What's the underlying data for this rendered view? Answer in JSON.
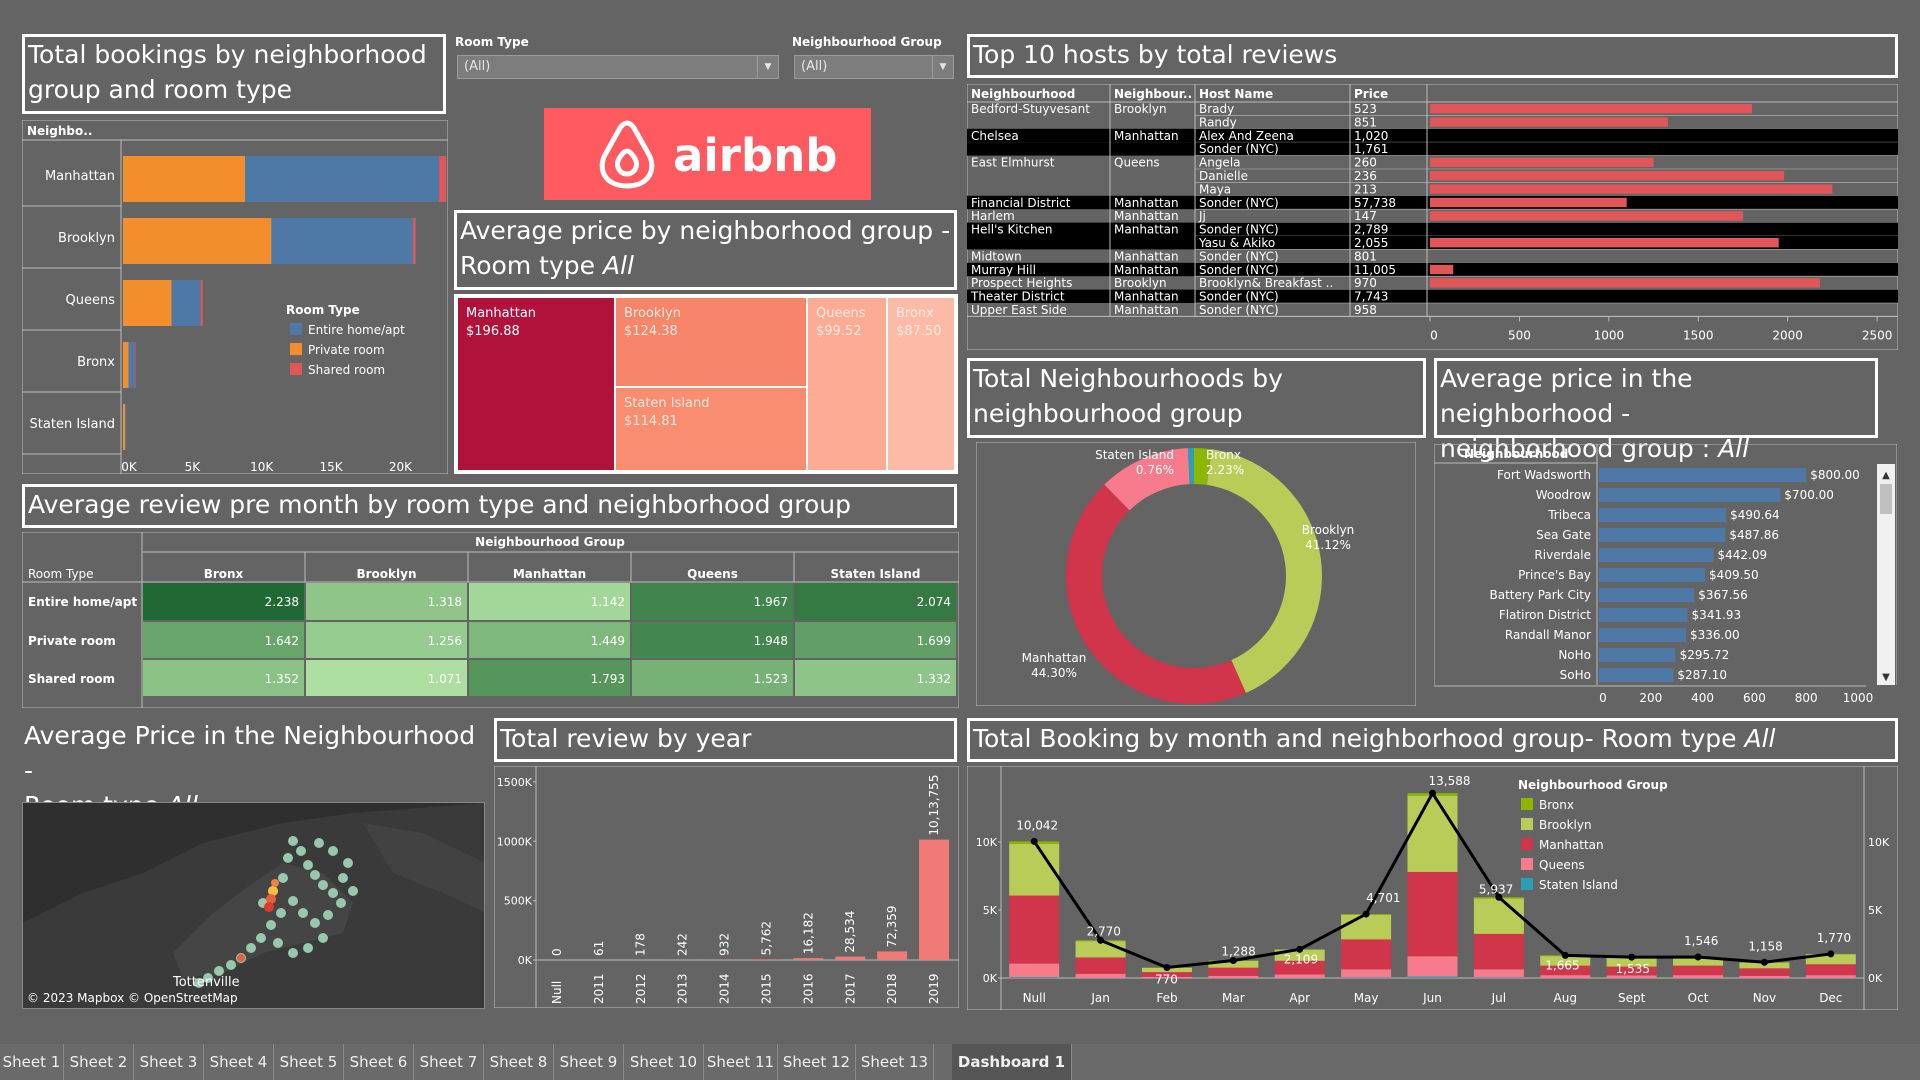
{
  "titles": {
    "bookings": "Total bookings by neighborhood\ngroup and room type",
    "avgprice_prefix": "Average price by neighborhood group -\nRoom type ",
    "avgprice_all": "All",
    "review_month": "Average review pre month by room type and neighborhood group",
    "map_prefix": "Average Price in the Neighbourhood -\nRoom type ",
    "map_all": "All",
    "review_year": "Total review by year",
    "top_hosts": "Top 10 hosts by total reviews",
    "total_neigh": "Total Neighbourhoods by\nneighbourhood group",
    "avg_neigh_prefix": "Average price in the neighborhood -\nneighborhood group : ",
    "avg_neigh_all": "All",
    "booking_month_prefix": "Total Booking by month and neighborhood group- Room type ",
    "booking_month_all": "All"
  },
  "filters": {
    "room_type_label": "Room Type",
    "room_type_value": "(All)",
    "neigh_group_label": "Neighbourhood Group",
    "neigh_group_value": "(All)"
  },
  "logo": {
    "text": "airbnb",
    "color": "#ff5a5f"
  },
  "map": {
    "place": "Tottenville",
    "credit": "© 2023 Mapbox © OpenStreetMap"
  },
  "tabs": [
    "Sheet 1",
    "Sheet 2",
    "Sheet 3",
    "Sheet 4",
    "Sheet 5",
    "Sheet 6",
    "Sheet 7",
    "Sheet 8",
    "Sheet 9",
    "Sheet 10",
    "Sheet 11",
    "Sheet 12",
    "Sheet 13",
    "Dashboard 1"
  ],
  "chart_data": [
    {
      "id": "bookings",
      "type": "bar",
      "orientation": "horizontal",
      "stacked": true,
      "row_header": "Neighbo..",
      "categories": [
        "Manhattan",
        "Brooklyn",
        "Queens",
        "Bronx",
        "Staten Island"
      ],
      "series": [
        {
          "name": "Private room",
          "color": "#f28e2b",
          "values": [
            8800,
            10700,
            3500,
            400,
            150
          ]
        },
        {
          "name": "Entire home/apt",
          "color": "#4e79a7",
          "values": [
            14000,
            10200,
            2100,
            450,
            80
          ]
        },
        {
          "name": "Shared room",
          "color": "#e15759",
          "values": [
            500,
            200,
            150,
            50,
            10
          ]
        }
      ],
      "legend_title": "Room Type",
      "legend": [
        {
          "name": "Entire home/apt",
          "color": "#4e79a7"
        },
        {
          "name": "Private room",
          "color": "#f28e2b"
        },
        {
          "name": "Shared room",
          "color": "#e15759"
        }
      ],
      "xlim": [
        0,
        23000
      ],
      "xticks": [
        "0K",
        "5K",
        "10K",
        "15K",
        "20K"
      ],
      "xtick_values": [
        0,
        5000,
        10000,
        15000,
        20000
      ]
    },
    {
      "id": "treemap",
      "type": "treemap",
      "items": [
        {
          "name": "Manhattan",
          "value": "$196.88",
          "color": "#b0123c"
        },
        {
          "name": "Brooklyn",
          "value": "$124.38",
          "color": "#f7856a"
        },
        {
          "name": "Staten Island",
          "value": "$114.81",
          "color": "#f98d70"
        },
        {
          "name": "Queens",
          "value": "$99.52",
          "color": "#fcab94"
        },
        {
          "name": "Bronx",
          "value": "$87.50",
          "color": "#fdbaa6"
        }
      ]
    },
    {
      "id": "review_month",
      "type": "heatmap",
      "group_header": "Neighbourhood Group",
      "row_header": "Room Type",
      "columns": [
        "Bronx",
        "Brooklyn",
        "Manhattan",
        "Queens",
        "Staten Island"
      ],
      "rows": [
        {
          "label": "Entire home/apt",
          "values": [
            "2.238",
            "1.318",
            "1.142",
            "1.967",
            "2.074"
          ]
        },
        {
          "label": "Private room",
          "values": [
            "1.642",
            "1.256",
            "1.449",
            "1.948",
            "1.699"
          ]
        },
        {
          "label": "Shared room",
          "values": [
            "1.352",
            "1.071",
            "1.793",
            "1.523",
            "1.332"
          ]
        }
      ]
    },
    {
      "id": "review_year",
      "type": "bar",
      "categories": [
        "Null",
        "2011",
        "2012",
        "2013",
        "2014",
        "2015",
        "2016",
        "2017",
        "2018",
        "2019"
      ],
      "values": [
        0,
        61,
        178,
        242,
        932,
        5762,
        16182,
        28534,
        72359,
        1013755
      ],
      "labels": [
        "0",
        "61",
        "178",
        "242",
        "932",
        "5,762",
        "16,182",
        "28,534",
        "72,359",
        "10,13,755"
      ],
      "ylim": [
        0,
        1600000
      ],
      "yticks": [
        "0K",
        "500K",
        "1000K",
        "1500K"
      ],
      "ytick_values": [
        0,
        500000,
        1000000,
        1500000
      ],
      "color": "#f07a78"
    },
    {
      "id": "top_hosts",
      "type": "table",
      "headers": [
        "Neighbourhood",
        "Neighbour..",
        "Host Name",
        "Price"
      ],
      "rows": [
        {
          "n": "Bedford-Stuyvesant",
          "g": "Brooklyn",
          "h": "Brady",
          "p": "523",
          "v": 1800,
          "dark": false
        },
        {
          "n": "",
          "g": "",
          "h": "Randy",
          "p": "851",
          "v": 1330,
          "dark": false
        },
        {
          "n": "Chelsea",
          "g": "Manhattan",
          "h": "Alex And Zeena",
          "p": "1,020",
          "v": 0,
          "dark": true
        },
        {
          "n": "",
          "g": "",
          "h": "Sonder (NYC)",
          "p": "1,761",
          "v": 0,
          "dark": true
        },
        {
          "n": "East Elmhurst",
          "g": "Queens",
          "h": "Angela",
          "p": "260",
          "v": 1250,
          "dark": false
        },
        {
          "n": "",
          "g": "",
          "h": "Danielle",
          "p": "236",
          "v": 1980,
          "dark": false
        },
        {
          "n": "",
          "g": "",
          "h": "Maya",
          "p": "213",
          "v": 2250,
          "dark": false
        },
        {
          "n": "Financial District",
          "g": "Manhattan",
          "h": "Sonder (NYC)",
          "p": "57,738",
          "v": 1100,
          "dark": true
        },
        {
          "n": "Harlem",
          "g": "Manhattan",
          "h": "Jj",
          "p": "147",
          "v": 1750,
          "dark": false
        },
        {
          "n": "Hell's Kitchen",
          "g": "Manhattan",
          "h": "Sonder (NYC)",
          "p": "2,789",
          "v": 0,
          "dark": true
        },
        {
          "n": "",
          "g": "",
          "h": "Yasu & Akiko",
          "p": "2,055",
          "v": 1950,
          "dark": true
        },
        {
          "n": "Midtown",
          "g": "Manhattan",
          "h": "Sonder (NYC)",
          "p": "801",
          "v": 0,
          "dark": false
        },
        {
          "n": "Murray Hill",
          "g": "Manhattan",
          "h": "Sonder (NYC)",
          "p": "11,005",
          "v": 130,
          "dark": true
        },
        {
          "n": "Prospect Heights",
          "g": "Brooklyn",
          "h": "Brooklyn&  Breakfast  ..",
          "p": "970",
          "v": 2180,
          "dark": false
        },
        {
          "n": "Theater District",
          "g": "Manhattan",
          "h": "Sonder (NYC)",
          "p": "7,743",
          "v": 0,
          "dark": true
        },
        {
          "n": "Upper East Side",
          "g": "Manhattan",
          "h": "Sonder (NYC)",
          "p": "958",
          "v": 0,
          "dark": false
        }
      ],
      "xlim": [
        0,
        2600
      ],
      "xticks": [
        "0",
        "500",
        "1000",
        "1500",
        "2000",
        "2500"
      ],
      "xtick_values": [
        0,
        500,
        1000,
        1500,
        2000,
        2500
      ],
      "color": "#e15759"
    },
    {
      "id": "donut",
      "type": "pie",
      "slices": [
        {
          "name": "Bronx",
          "pct": 2.23,
          "label": "2.23%",
          "color": "#8db600"
        },
        {
          "name": "Brooklyn",
          "pct": 41.12,
          "label": "41.12%",
          "color": "#b9cc57"
        },
        {
          "name": "Manhattan",
          "pct": 44.3,
          "label": "44.30%",
          "color": "#d0354c"
        },
        {
          "name": "Queens",
          "pct": 11.59,
          "label": "",
          "color": "#f77b8b"
        },
        {
          "name": "Staten Island",
          "pct": 0.76,
          "label": "0.76%",
          "color": "#2a9fb5"
        }
      ]
    },
    {
      "id": "avg_neigh",
      "type": "bar",
      "orientation": "horizontal",
      "row_header": "Neighbourhood",
      "categories": [
        "Fort Wadsworth",
        "Woodrow",
        "Tribeca",
        "Sea Gate",
        "Riverdale",
        "Prince's Bay",
        "Battery Park City",
        "Flatiron District",
        "Randall Manor",
        "NoHo",
        "SoHo"
      ],
      "values": [
        800,
        700,
        490.64,
        487.86,
        442.09,
        409.5,
        367.56,
        341.93,
        336.0,
        295.72,
        287.1
      ],
      "labels": [
        "$800.00",
        "$700.00",
        "$490.64",
        "$487.86",
        "$442.09",
        "$409.50",
        "$367.56",
        "$341.93",
        "$336.00",
        "$295.72",
        "$287.10"
      ],
      "xlim": [
        0,
        1000
      ],
      "xticks": [
        "0",
        "200",
        "400",
        "600",
        "800",
        "1000"
      ],
      "xtick_values": [
        0,
        200,
        400,
        600,
        800,
        1000
      ],
      "color": "#4e79a7"
    },
    {
      "id": "booking_month",
      "type": "bar",
      "stacked": true,
      "categories": [
        "Null",
        "Jan",
        "Feb",
        "Mar",
        "Apr",
        "May",
        "Jun",
        "Jul",
        "Aug",
        "Sept",
        "Oct",
        "Nov",
        "Dec"
      ],
      "series": [
        {
          "name": "Staten Island",
          "color": "#2a9fb5",
          "values": [
            60,
            10,
            5,
            10,
            15,
            40,
            100,
            40,
            10,
            10,
            10,
            10,
            10
          ]
        },
        {
          "name": "Queens",
          "color": "#f77b8b",
          "values": [
            1000,
            300,
            80,
            150,
            250,
            600,
            1500,
            600,
            200,
            180,
            200,
            150,
            200
          ]
        },
        {
          "name": "Manhattan",
          "color": "#d0354c",
          "values": [
            5000,
            1200,
            350,
            600,
            1000,
            2200,
            6200,
            2600,
            700,
            650,
            700,
            550,
            800
          ]
        },
        {
          "name": "Brooklyn",
          "color": "#b9cc57",
          "values": [
            3800,
            1200,
            320,
            500,
            820,
            1800,
            5600,
            2600,
            700,
            650,
            600,
            420,
            720
          ]
        },
        {
          "name": "Bronx",
          "color": "#8db600",
          "values": [
            182,
            60,
            15,
            28,
            24,
            61,
            188,
            97,
            55,
            45,
            36,
            28,
            40
          ]
        }
      ],
      "line": {
        "values": [
          10042,
          2770,
          770,
          1288,
          2109,
          4701,
          13588,
          5937,
          1665,
          1535,
          1546,
          1158,
          1770
        ],
        "labels": [
          "10,042",
          "2,770",
          "770",
          "1,288",
          "2,109",
          "4,701",
          "13,588",
          "5,937",
          "1,665",
          "1,535",
          "1,546",
          "1,158",
          "1,770"
        ]
      },
      "ylim": [
        0,
        15000
      ],
      "yticks": [
        "0K",
        "5K",
        "10K"
      ],
      "ytick_values": [
        0,
        5000,
        10000
      ],
      "legend_title": "Neighbourhood Group",
      "legend": [
        {
          "name": "Bronx",
          "color": "#8db600"
        },
        {
          "name": "Brooklyn",
          "color": "#b9cc57"
        },
        {
          "name": "Manhattan",
          "color": "#d0354c"
        },
        {
          "name": "Queens",
          "color": "#f77b8b"
        },
        {
          "name": "Staten Island",
          "color": "#2a9fb5"
        }
      ]
    }
  ]
}
